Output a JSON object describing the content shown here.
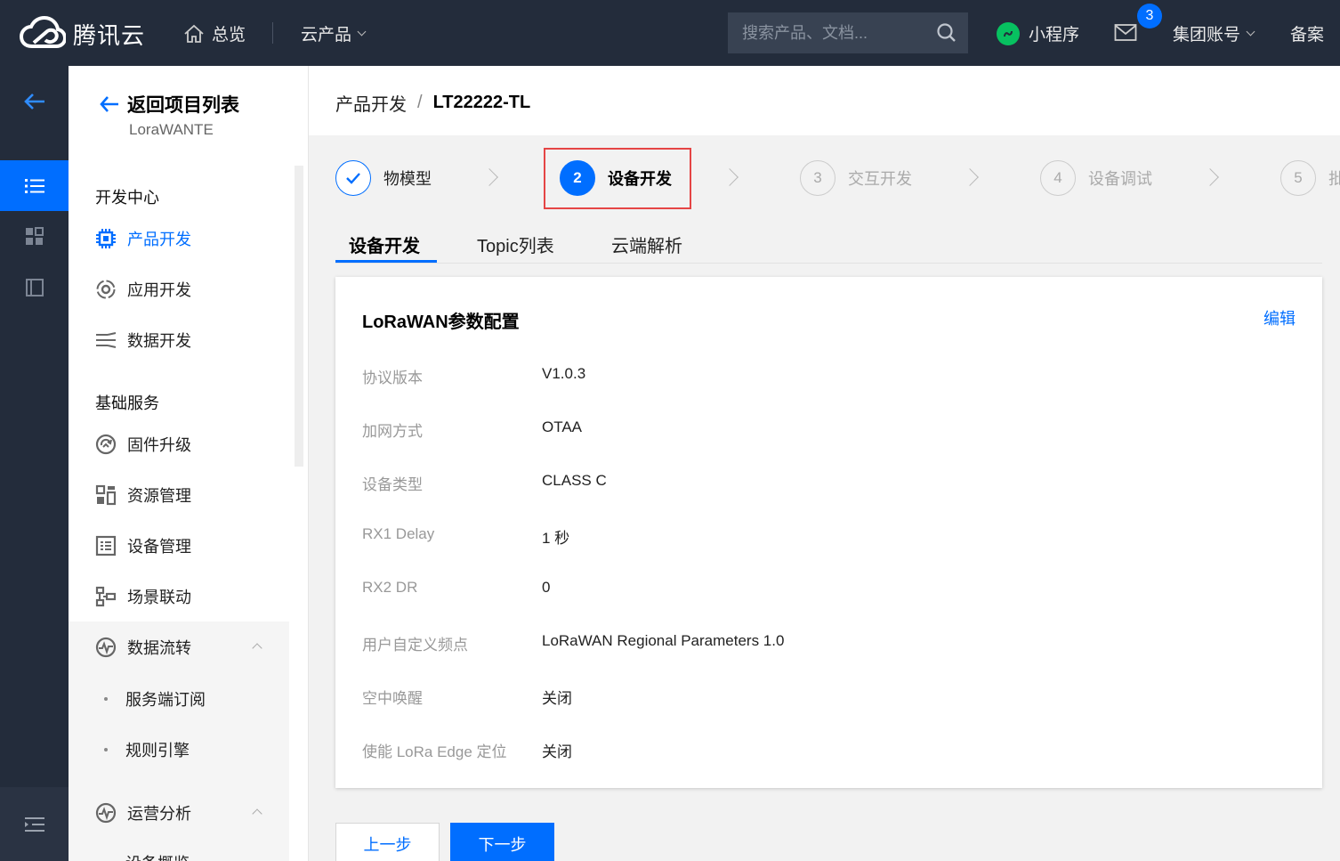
{
  "topbar": {
    "brand": "腾讯云",
    "overview": "总览",
    "products": "云产品",
    "search_placeholder": "搜索产品、文档...",
    "miniprogram": "小程序",
    "mail_badge": "3",
    "group_account": "集团账号",
    "beian": "备案"
  },
  "sidebar": {
    "back_label": "返回项目列表",
    "project_name": "LoraWANTE",
    "section_dev": "开发中心",
    "section_base": "基础服务",
    "items": {
      "product_dev": "产品开发",
      "app_dev": "应用开发",
      "data_dev": "数据开发",
      "firmware": "固件升级",
      "resource": "资源管理",
      "device": "设备管理",
      "scene": "场景联动",
      "data_flow": "数据流转",
      "server_sub": "服务端订阅",
      "rule_engine": "规则引擎",
      "ops_analysis": "运营分析",
      "device_overview": "设备概览"
    }
  },
  "breadcrumb": {
    "parent": "产品开发",
    "separator": "/",
    "current": "LT22222-TL"
  },
  "steps": [
    {
      "num": "",
      "label": "物模型",
      "state": "done"
    },
    {
      "num": "2",
      "label": "设备开发",
      "state": "current"
    },
    {
      "num": "3",
      "label": "交互开发",
      "state": "todo"
    },
    {
      "num": "4",
      "label": "设备调试",
      "state": "todo"
    },
    {
      "num": "5",
      "label": "批",
      "state": "todo"
    }
  ],
  "tabs": [
    "设备开发",
    "Topic列表",
    "云端解析"
  ],
  "card": {
    "title": "LoRaWAN参数配置",
    "edit": "编辑",
    "rows": [
      {
        "key": "协议版本",
        "value": "V1.0.3"
      },
      {
        "key": "加网方式",
        "value": "OTAA"
      },
      {
        "key": "设备类型",
        "value": "CLASS C"
      },
      {
        "key": "RX1 Delay",
        "value": "1 秒"
      },
      {
        "key": "RX2 DR",
        "value": "0"
      },
      {
        "key": "用户自定义频点",
        "value": "LoRaWAN Regional Parameters 1.0"
      },
      {
        "key": "空中唤醒",
        "value": "关闭"
      },
      {
        "key": "使能 LoRa Edge 定位",
        "value": "关闭"
      }
    ]
  },
  "buttons": {
    "prev": "上一步",
    "next": "下一步"
  },
  "colors": {
    "topbar": "#232c3b",
    "accent": "#006eff",
    "highlight": "#e54545"
  }
}
